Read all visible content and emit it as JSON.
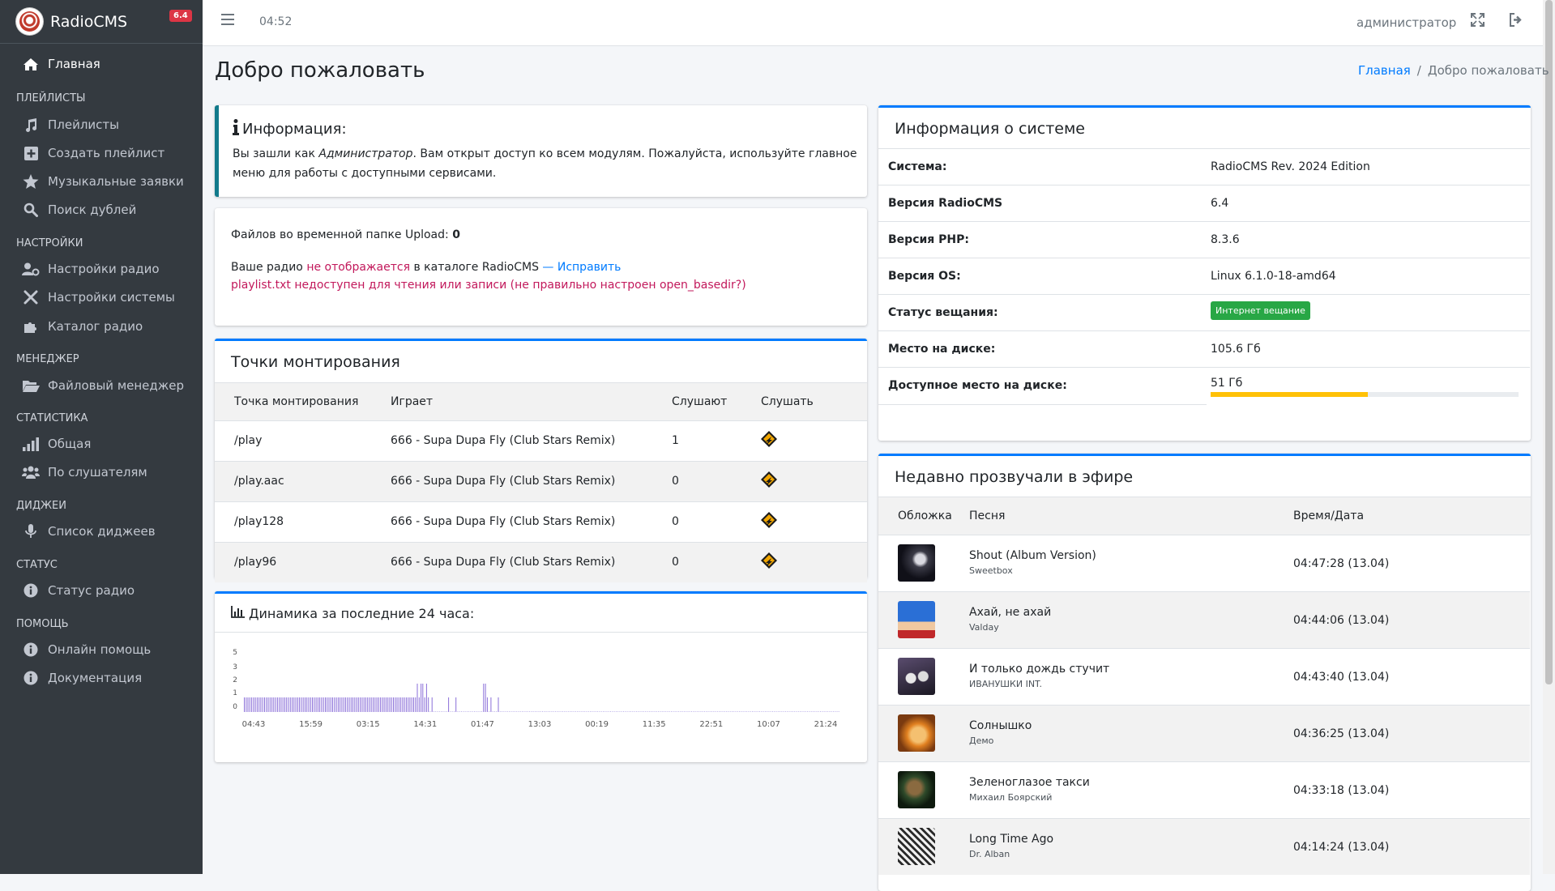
{
  "brand": {
    "name": "RadioCMS",
    "version_badge": "6.4"
  },
  "sidebar": {
    "home": "Главная",
    "sections": [
      {
        "header": "ПЛЕЙЛИСТЫ",
        "items": [
          "Плейлисты",
          "Создать плейлист",
          "Музыкальные заявки",
          "Поиск дублей"
        ]
      },
      {
        "header": "НАСТРОЙКИ",
        "items": [
          "Настройки радио",
          "Настройки системы",
          "Каталог радио"
        ]
      },
      {
        "header": "МЕНЕДЖЕР",
        "items": [
          "Файловый менеджер"
        ]
      },
      {
        "header": "СТАТИСТИКА",
        "items": [
          "Общая",
          "По слушателям"
        ]
      },
      {
        "header": "ДИДЖЕИ",
        "items": [
          "Список диджеев"
        ]
      },
      {
        "header": "СТАТУС",
        "items": [
          "Статус радио"
        ]
      },
      {
        "header": "ПОМОЩЬ",
        "items": [
          "Онлайн помощь",
          "Документация"
        ]
      }
    ]
  },
  "topbar": {
    "time": "04:52",
    "user": "администратор"
  },
  "page": {
    "title": "Добро пожаловать"
  },
  "breadcrumb": {
    "home": "Главная",
    "separator": "/",
    "current": "Добро пожаловать"
  },
  "info": {
    "title": "Информация:",
    "text_before": "Вы зашли как ",
    "role": "Администратор",
    "text_after": ". Вам открыт доступ ко всем модулям. Пожалуйста, используйте главное меню для работы с доступными сервисами."
  },
  "status_box": {
    "upload_label": "Файлов во временной папке Upload: ",
    "upload_count": "0",
    "catalog_before": "Ваше радио ",
    "catalog_warn": "не отображается",
    "catalog_after": " в каталоге RadioCMS",
    "catalog_dash": " — ",
    "catalog_fix": "Исправить",
    "playlist_warn": "playlist.txt недоступен для чтения или записи (не правильно настроен open_basedir?)"
  },
  "mounts": {
    "title": "Точки монтирования",
    "columns": [
      "Точка монтирования",
      "Играет",
      "Слушают",
      "Слушать"
    ],
    "rows": [
      {
        "mount": "/play",
        "playing": "666 - Supa Dupa Fly (Club Stars Remix)",
        "listeners": "1"
      },
      {
        "mount": "/play.aac",
        "playing": "666 - Supa Dupa Fly (Club Stars Remix)",
        "listeners": "0"
      },
      {
        "mount": "/play128",
        "playing": "666 - Supa Dupa Fly (Club Stars Remix)",
        "listeners": "0"
      },
      {
        "mount": "/play96",
        "playing": "666 - Supa Dupa Fly (Club Stars Remix)",
        "listeners": "0"
      }
    ]
  },
  "dynamics": {
    "title": "Динамика за последние 24 часа:"
  },
  "chart_data": {
    "type": "bar",
    "title": "Динамика за последние 24 часа:",
    "y_ticks": [
      "5",
      "3",
      "2",
      "1",
      "0"
    ],
    "ylim": [
      0,
      5
    ],
    "x_ticks": [
      "04:43",
      "15:59",
      "03:15",
      "14:31",
      "01:47",
      "13:03",
      "00:19",
      "11:35",
      "22:51",
      "10:07",
      "21:24"
    ],
    "values": [
      1,
      1,
      1,
      1,
      1,
      1,
      1,
      1,
      1,
      1,
      1,
      1,
      1,
      1,
      1,
      1,
      1,
      1,
      1,
      1,
      1,
      1,
      1,
      1,
      1,
      1,
      1,
      1,
      1,
      1,
      1,
      1,
      1,
      1,
      1,
      1,
      1,
      1,
      1,
      1,
      1,
      1,
      1,
      1,
      1,
      1,
      1,
      1,
      1,
      1,
      1,
      1,
      1,
      1,
      1,
      1,
      1,
      1,
      1,
      1,
      1,
      1,
      1,
      1,
      1,
      1,
      1,
      1,
      1,
      1,
      1,
      1,
      1,
      1,
      1,
      1,
      1,
      1,
      1,
      1,
      1,
      1,
      1,
      1,
      1,
      1,
      1,
      1,
      1,
      1,
      1,
      1,
      1,
      1,
      2,
      1,
      2,
      2,
      1,
      2,
      1,
      0,
      1,
      0,
      0,
      0,
      0,
      0,
      0,
      0,
      0,
      1,
      0,
      0,
      0,
      1,
      0,
      0,
      0,
      0,
      0,
      0,
      0,
      0,
      0,
      0,
      0,
      0,
      0,
      0,
      2,
      2,
      1,
      0,
      1,
      0,
      0,
      0,
      1,
      0,
      0,
      0,
      0,
      0,
      0,
      0,
      0,
      0,
      0,
      0,
      0,
      0,
      0,
      0,
      0,
      0,
      0,
      0,
      0,
      0,
      0,
      0,
      0,
      0,
      0,
      0,
      0,
      0,
      0,
      0,
      0,
      0,
      0,
      0,
      0,
      0,
      0,
      0,
      0,
      0,
      0,
      0,
      0,
      0,
      0,
      0,
      0,
      0,
      0,
      0,
      0,
      0,
      0,
      0,
      0,
      0,
      0,
      0,
      0,
      0,
      0,
      0,
      0,
      0,
      0,
      0,
      0,
      0,
      0,
      0,
      0,
      0,
      0,
      0,
      0,
      0,
      0,
      0,
      0,
      0,
      0,
      0,
      0,
      0,
      0,
      0,
      0,
      0,
      0,
      0,
      0,
      0,
      0,
      0,
      0,
      0,
      0,
      0,
      0,
      0,
      0,
      0,
      0,
      0,
      0,
      0,
      0,
      0,
      0,
      0,
      0,
      0,
      0,
      0,
      0,
      0,
      0,
      0,
      0,
      0,
      0,
      0,
      0,
      0,
      0,
      0,
      0,
      0,
      0,
      0,
      0,
      0,
      0,
      0,
      0,
      0,
      0,
      0,
      0,
      0,
      0,
      0,
      0,
      0,
      0,
      0,
      0,
      0,
      0,
      0,
      0,
      0,
      0,
      0,
      0,
      0,
      0,
      0,
      0,
      0,
      0,
      0,
      0,
      0,
      0,
      0,
      0,
      0,
      0,
      0,
      0,
      0,
      0,
      0,
      0,
      0,
      0,
      0,
      0,
      0,
      0,
      0,
      0,
      0
    ],
    "color": "#8a6fd8",
    "grid": false
  },
  "system": {
    "title": "Информация о системе",
    "rows": [
      {
        "key": "Система:",
        "value": "RadioCMS Rev. 2024 Edition"
      },
      {
        "key": "Версия RadioCMS",
        "value": "6.4"
      },
      {
        "key": "Версия PHP:",
        "value": "8.3.6"
      },
      {
        "key": "Версия OS:",
        "value": "Linux 6.1.0-18-amd64"
      },
      {
        "key": "Статус вещания:",
        "value": "Интернет вещание"
      },
      {
        "key": "Место на диске:",
        "value": "105.6 Гб"
      },
      {
        "key": "Доступное место на диске:",
        "value": "51 Гб"
      }
    ],
    "disk_free_fraction": 0.51,
    "status_color": "#28a745",
    "progress_color": "#ffc107"
  },
  "recent": {
    "title": "Недавно прозвучали в эфире",
    "columns": [
      "Обложка",
      "Песня",
      "Время/Дата"
    ],
    "rows": [
      {
        "song": "Shout (Album Version)",
        "artist": "Sweetbox",
        "time": "04:47:28 (13.04)"
      },
      {
        "song": "Ахай, не ахай",
        "artist": "Valday",
        "time": "04:44:06 (13.04)"
      },
      {
        "song": "И только дождь стучит",
        "artist": "ИВАНУШКИ INT.",
        "time": "04:43:40 (13.04)"
      },
      {
        "song": "Солнышко",
        "artist": "Демо",
        "time": "04:36:25 (13.04)"
      },
      {
        "song": "Зеленоглазое такси",
        "artist": "Михаил Боярский",
        "time": "04:33:18 (13.04)"
      },
      {
        "song": "Long Time Ago",
        "artist": "Dr. Alban",
        "time": "04:14:24 (13.04)"
      }
    ]
  },
  "colors": {
    "sidebar_bg": "#343a40",
    "accent": "#007bff",
    "warn": "#c2185b",
    "callout": "#117a8b"
  }
}
